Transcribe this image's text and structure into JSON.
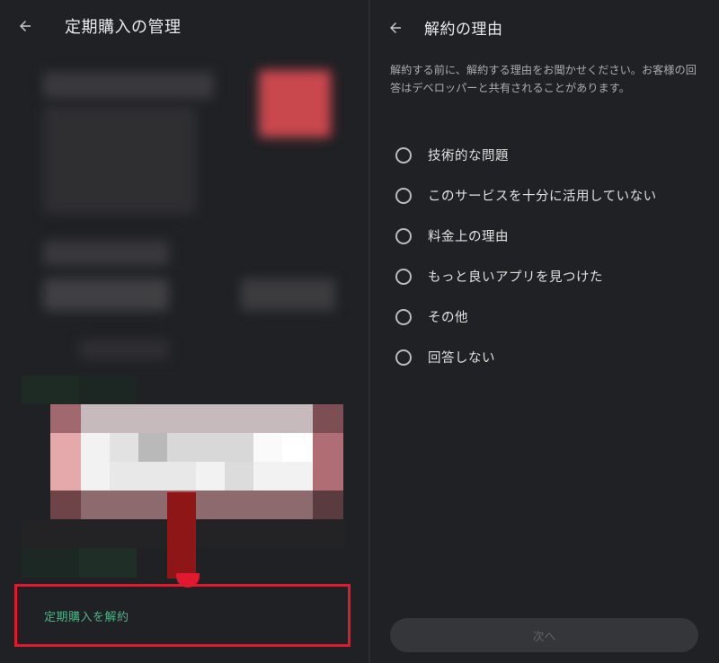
{
  "left_panel": {
    "title": "定期購入の管理",
    "cancel_subscription_label": "定期購入を解約",
    "colors": {
      "highlight_border": "#e0192e",
      "link": "#4ab387"
    }
  },
  "right_panel": {
    "title": "解約の理由",
    "intro": "解約する前に、解約する理由をお聞かせください。お客様の回答はデベロッパーと共有されることがあります。",
    "options": [
      "技術的な問題",
      "このサービスを十分に活用していない",
      "料金上の理由",
      "もっと良いアプリを見つけた",
      "その他",
      "回答しない"
    ],
    "next_label": "次へ"
  }
}
